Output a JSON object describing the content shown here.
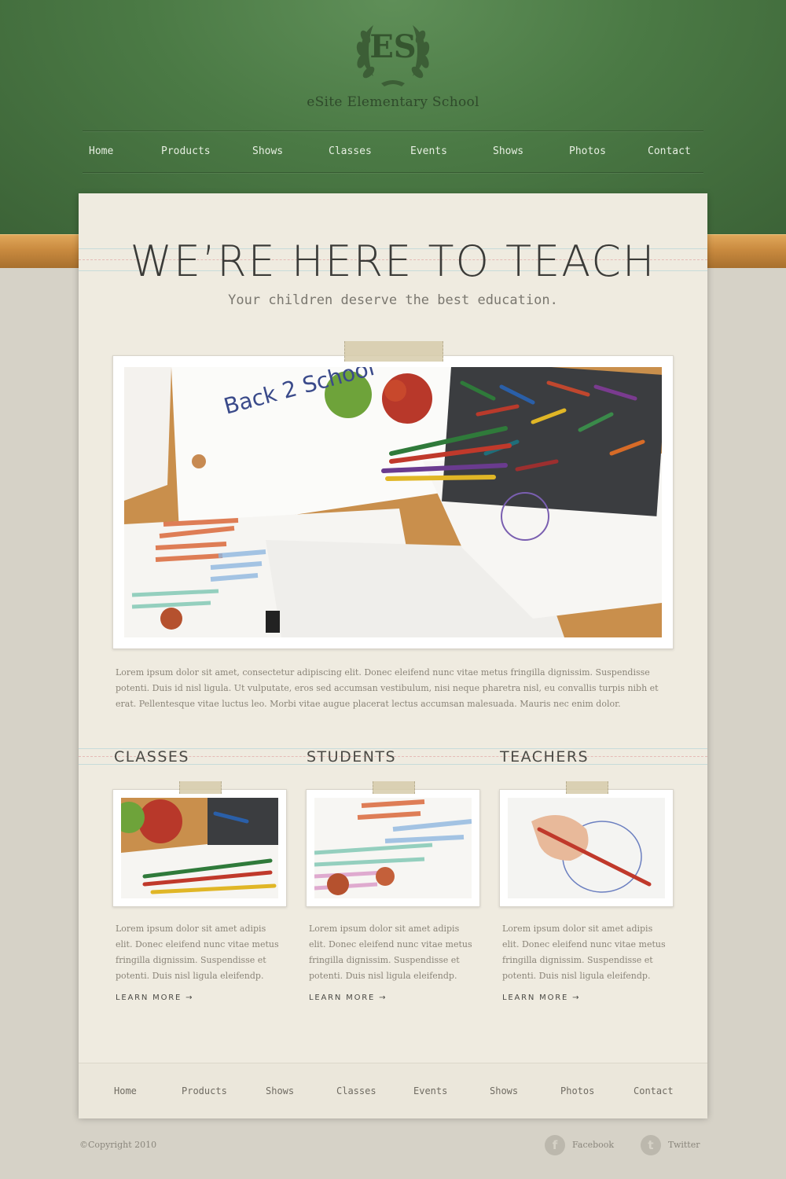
{
  "header": {
    "logo_text": "ES",
    "site_name": "eSite Elementary School"
  },
  "nav": [
    "Home",
    "Products",
    "Shows",
    "Classes",
    "Events",
    "Shows",
    "Photos",
    "Contact"
  ],
  "hero": {
    "headline": "WE’RE HERE TO TEACH",
    "subline": "Your children deserve the best education.",
    "note_text": "Back 2 School"
  },
  "intro": "Lorem ipsum dolor sit amet, consectetur adipiscing elit. Donec eleifend nunc vitae metus fringilla dignissim. Suspendisse potenti. Duis id nisl ligula. Ut vulputate, eros sed accumsan vestibulum, nisi neque pharetra nisl, eu convallis turpis nibh et erat. Pellentesque vitae luctus leo. Morbi vitae augue placerat lectus accumsan malesuada. Mauris nec enim dolor.",
  "columns": [
    {
      "title": "CLASSES",
      "text": "Lorem ipsum dolor sit amet adipis elit. Donec eleifend nunc vitae metus fringilla dignissim. Suspendisse et potenti. Duis nisl ligula eleifendp.",
      "more": "LEARN MORE →"
    },
    {
      "title": "STUDENTS",
      "text": "Lorem ipsum dolor sit amet adipis elit. Donec eleifend nunc vitae metus fringilla dignissim. Suspendisse et potenti. Duis nisl ligula eleifendp.",
      "more": "LEARN MORE →"
    },
    {
      "title": "TEACHERS",
      "text": "Lorem ipsum dolor sit amet adipis elit. Donec eleifend nunc vitae metus fringilla dignissim. Suspendisse et potenti. Duis nisl ligula eleifendp.",
      "more": "LEARN MORE →"
    }
  ],
  "footer_nav": [
    "Home",
    "Products",
    "Shows",
    "Classes",
    "Events",
    "Shows",
    "Photos",
    "Contact"
  ],
  "footer": {
    "copyright": "©Copyright 2010",
    "social": [
      {
        "label": "Facebook",
        "icon": "facebook-icon",
        "glyph": "f"
      },
      {
        "label": "Twitter",
        "icon": "twitter-icon",
        "glyph": "t"
      }
    ]
  },
  "colors": {
    "chalkboard": "#4b7a45",
    "wood_ledge": "#c98a3f",
    "paper": "#efebe0",
    "background": "#d6d2c7",
    "text_dark": "#3b3b38",
    "text_body": "#8a8478"
  }
}
